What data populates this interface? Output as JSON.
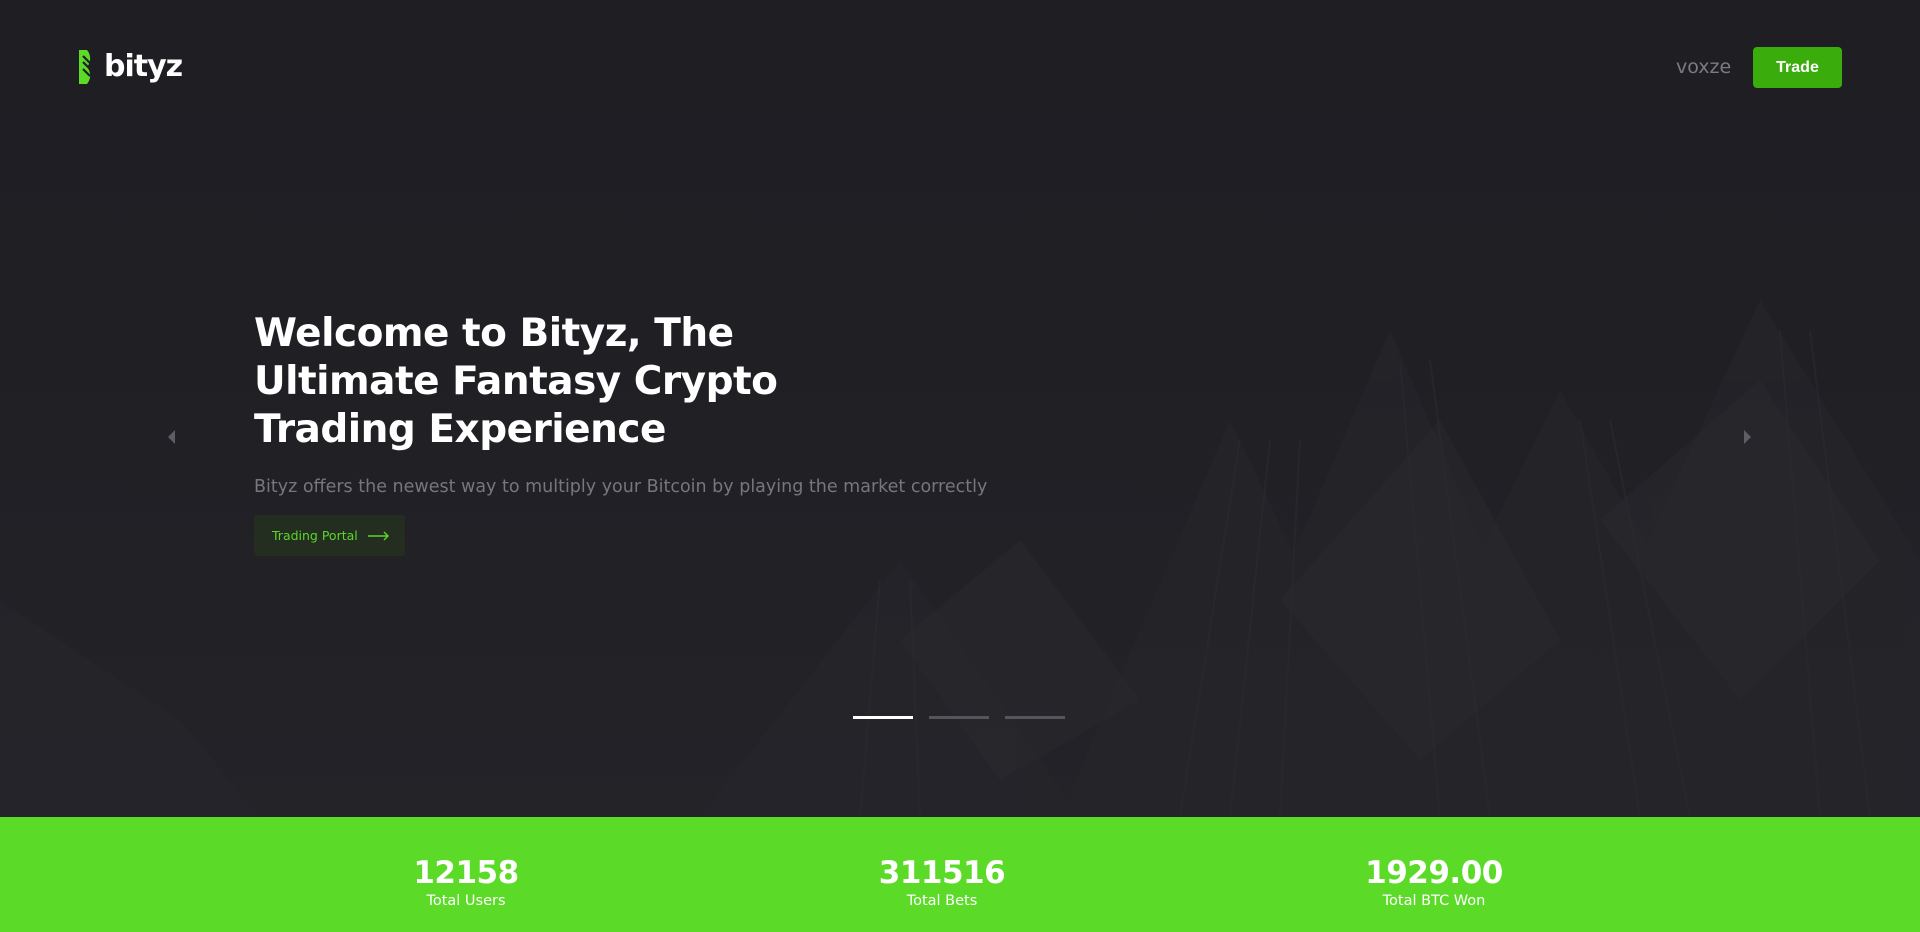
{
  "brand": {
    "name": "bityz",
    "accent": "#5cda28",
    "button_green": "#3aad0d"
  },
  "header": {
    "username": "voxze",
    "trade_label": "Trade"
  },
  "hero": {
    "title": "Welcome to Bityz, The Ultimate Fantasy Crypto Trading Experience",
    "subtitle": "Bityz offers the newest way to multiply your Bitcoin by playing the market correctly",
    "cta_label": "Trading Portal",
    "icons": {
      "prev": "chevron-left-icon",
      "next": "chevron-right-icon",
      "cta": "arrow-right-icon"
    },
    "slides": {
      "count": 3,
      "active": 1
    }
  },
  "stats": [
    {
      "value": "12158",
      "label": "Total Users"
    },
    {
      "value": "311516",
      "label": "Total Bets"
    },
    {
      "value": "1929.00",
      "label": "Total BTC Won"
    }
  ]
}
